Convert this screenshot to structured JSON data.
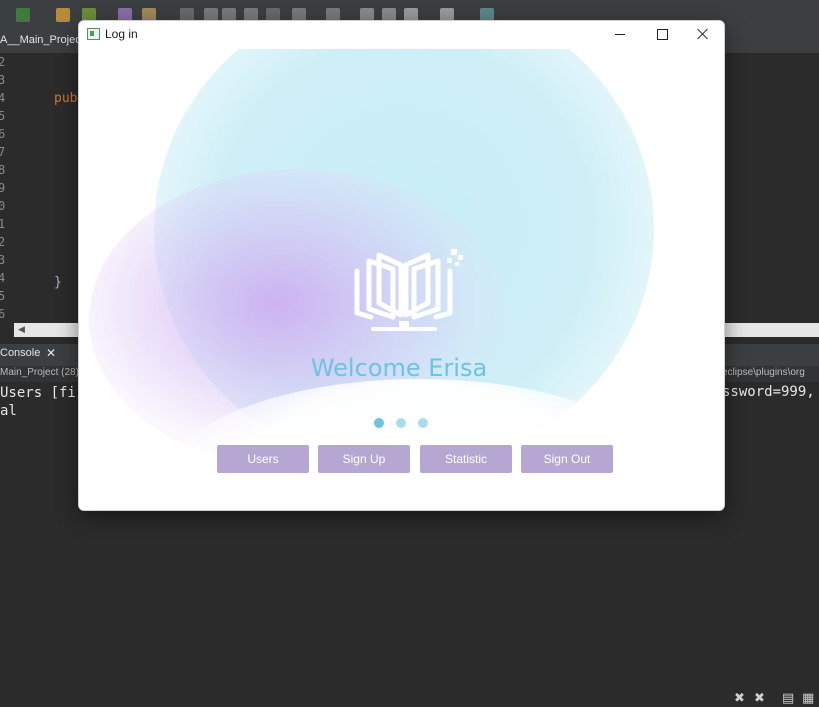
{
  "ide": {
    "editor_tab": "A__Main_Project",
    "line_numbers": [
      "2",
      "3",
      "4",
      "5",
      "6",
      "7",
      "8",
      "9",
      "0",
      "1",
      "2",
      "3",
      "4",
      "5",
      "6"
    ],
    "code_keyword": "pub",
    "code_brace": "}",
    "console_tab": "Console",
    "console_path_left": "Main_Project (28)",
    "console_path_right": "eclipse\\plugins\\org",
    "console_lines": [
      "Users [fi",
      "al"
    ],
    "console_line_right": "ssword=999,"
  },
  "window": {
    "title": "Log in",
    "welcome_text": "Welcome Erisa",
    "carousel": {
      "count": 3,
      "active_index": 0
    },
    "buttons": [
      "Users",
      "Sign Up",
      "Statistic",
      "Sign Out"
    ],
    "colors": {
      "button_bg": "#b6a7d2",
      "welcome_text": "#6cc4e0",
      "dot_active": "#6ec3df",
      "dot_inactive": "#a9ddec"
    },
    "icons": [
      "book-logo-icon",
      "app-window-icon",
      "minimize-icon",
      "maximize-icon",
      "close-icon"
    ]
  }
}
